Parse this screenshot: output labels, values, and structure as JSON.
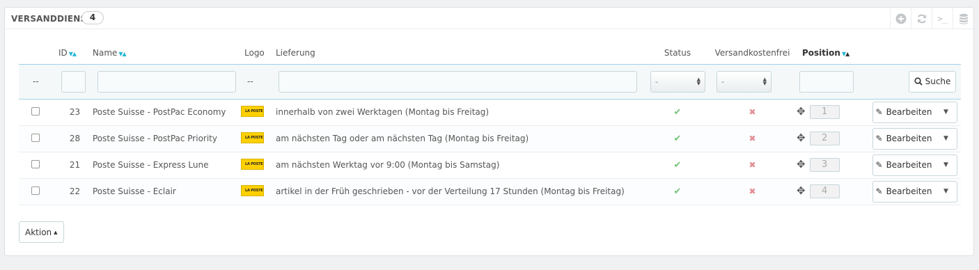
{
  "panel": {
    "title": "VERSANDDIENSTE",
    "count": "4",
    "tools": [
      "add-icon",
      "refresh-icon",
      "sql-console-icon",
      "database-export-icon"
    ],
    "console_glyph": ">_"
  },
  "columns": {
    "id": "ID",
    "name": "Name",
    "logo": "Logo",
    "delivery": "Lieferung",
    "status": "Status",
    "free": "Versandkostenfrei",
    "position": "Position"
  },
  "filters": {
    "id_placeholder": "",
    "name_placeholder": "",
    "logo": "--",
    "checkbox": "--",
    "status_value": "-",
    "free_value": "-",
    "search_label": "Suche"
  },
  "rows": [
    {
      "id": "23",
      "name": "Poste Suisse - PostPac Economy",
      "logo_text": "LA POSTE",
      "delivery": "innerhalb von zwei Werktagen (Montag bis Freitag)",
      "position": "1",
      "edit": "Bearbeiten"
    },
    {
      "id": "28",
      "name": "Poste Suisse - PostPac Priority",
      "logo_text": "LA POSTE",
      "delivery": "am nächsten Tag oder am nächsten Tag (Montag bis Freitag)",
      "position": "2",
      "edit": "Bearbeiten"
    },
    {
      "id": "21",
      "name": "Poste Suisse - Express Lune",
      "logo_text": "LA POSTE",
      "delivery": "am nächsten Werktag vor 9:00 (Montag bis Samstag)",
      "position": "3",
      "edit": "Bearbeiten"
    },
    {
      "id": "22",
      "name": "Poste Suisse - Eclair",
      "logo_text": "LA POSTE",
      "delivery": "artikel in der Früh geschrieben - vor der Verteilung 17 Stunden (Montag bis Freitag)",
      "position": "4",
      "edit": "Bearbeiten"
    }
  ],
  "bulk_action_label": "Aktion",
  "colors": {
    "accent": "#25b9d7",
    "ok": "#72c279",
    "no": "#e08f95",
    "logo": "#ffd000"
  }
}
